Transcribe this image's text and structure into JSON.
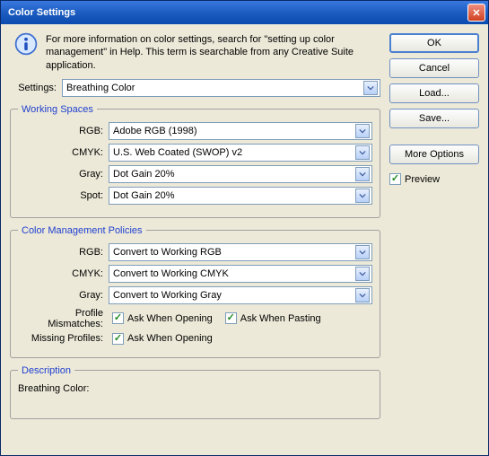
{
  "title": "Color Settings",
  "info_text": "For more information on color settings, search for \"setting up color management\" in Help. This term is searchable from any Creative Suite application.",
  "settings_label": "Settings:",
  "settings_value": "Breathing Color",
  "working_spaces": {
    "legend": "Working Spaces",
    "rgb_label": "RGB:",
    "rgb_value": "Adobe RGB (1998)",
    "cmyk_label": "CMYK:",
    "cmyk_value": "U.S. Web Coated (SWOP) v2",
    "gray_label": "Gray:",
    "gray_value": "Dot Gain 20%",
    "spot_label": "Spot:",
    "spot_value": "Dot Gain 20%"
  },
  "policies": {
    "legend": "Color Management Policies",
    "rgb_label": "RGB:",
    "rgb_value": "Convert to Working RGB",
    "cmyk_label": "CMYK:",
    "cmyk_value": "Convert to Working CMYK",
    "gray_label": "Gray:",
    "gray_value": "Convert to Working Gray",
    "mismatch_label": "Profile Mismatches:",
    "mismatch_open": "Ask When Opening",
    "mismatch_paste": "Ask When Pasting",
    "missing_label": "Missing Profiles:",
    "missing_open": "Ask When Opening"
  },
  "description": {
    "legend": "Description",
    "label": "Breathing Color:"
  },
  "buttons": {
    "ok": "OK",
    "cancel": "Cancel",
    "load": "Load...",
    "save": "Save...",
    "more": "More Options"
  },
  "preview_label": "Preview"
}
